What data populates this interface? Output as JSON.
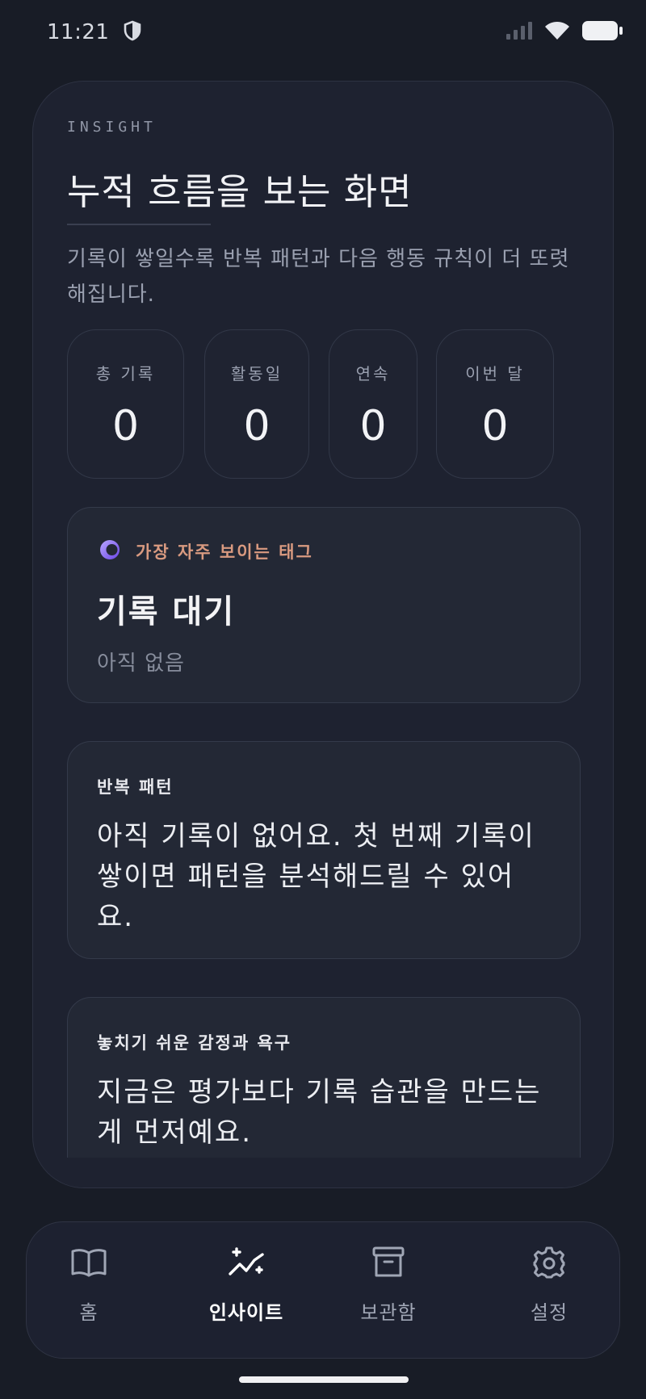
{
  "status_bar": {
    "time": "11:21"
  },
  "header": {
    "eyebrow": "INSIGHT",
    "title": "누적 흐름을 보는 화면",
    "description": "기록이 쌓일수록 반복 패턴과 다음 행동 규칙이 더 또렷해집니다."
  },
  "stats": [
    {
      "label": "총 기록",
      "value": "0"
    },
    {
      "label": "활동일",
      "value": "0"
    },
    {
      "label": "연속",
      "value": "0"
    },
    {
      "label": "이번 달",
      "value": "0"
    }
  ],
  "top_tag": {
    "label": "가장 자주 보이는 태그",
    "title": "기록 대기",
    "subtitle": "아직 없음"
  },
  "patterns": {
    "label": "반복 패턴",
    "body": "아직 기록이 없어요. 첫 번째 기록이 쌓이면 패턴을 분석해드릴 수 있어요."
  },
  "emotions": {
    "label": "놓치기 쉬운 감정과 욕구",
    "body": "지금은 평가보다 기록 습관을 만드는 게 먼저예요."
  },
  "nav": {
    "items": [
      {
        "label": "홈",
        "icon": "book-icon"
      },
      {
        "label": "인사이트",
        "icon": "sparkle-chart-icon"
      },
      {
        "label": "보관함",
        "icon": "archive-icon"
      },
      {
        "label": "설정",
        "icon": "gear-icon"
      }
    ],
    "active": "인사이트"
  },
  "colors": {
    "background": "#181c26",
    "card": "#1e2230",
    "accent_tag": "#d99a80",
    "tag_icon": "#8a6cf0"
  }
}
